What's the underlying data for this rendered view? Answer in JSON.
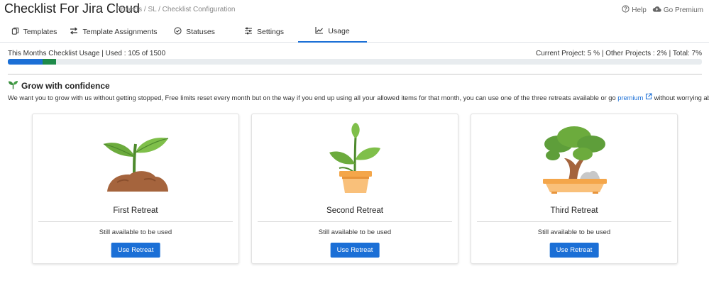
{
  "header": {
    "app_title": "Checklist For Jira Cloud",
    "breadcrumb": "Projects / SL / Checklist Configuration",
    "help_label": "Help",
    "premium_label": "Go Premium"
  },
  "tabs": [
    {
      "label": "Templates",
      "icon": "copy-icon"
    },
    {
      "label": "Template Assignments",
      "icon": "swap-arrows-icon"
    },
    {
      "label": "Statuses",
      "icon": "check-circle-icon"
    },
    {
      "label": "Settings",
      "icon": "sliders-icon"
    },
    {
      "label": "Usage",
      "icon": "chart-line-icon",
      "active": true
    }
  ],
  "usage": {
    "left_text": "This Months Checklist Usage | Used : 105 of 1500",
    "right_text": "Current Project: 5 % | Other Projects : 2% | Total: 7%",
    "current_project_percent": 5,
    "other_projects_percent": 2,
    "colors": {
      "current": "#1b6fd6",
      "other": "#1e8a4a"
    }
  },
  "section": {
    "title": "Grow with confidence",
    "desc_before": "We want you to grow with us without getting stopped, Free limits reset every month but on the way if you end up using all your allowed items for that month, you can use one of the three retreats available or go",
    "desc_link": "premium",
    "desc_after": "without worrying about limits."
  },
  "retreats": [
    {
      "title": "First Retreat",
      "status": "Still available to be used",
      "button_label": "Use Retreat",
      "illustration": "sprout-in-soil-icon"
    },
    {
      "title": "Second Retreat",
      "status": "Still available to be used",
      "button_label": "Use Retreat",
      "illustration": "plant-in-pot-icon"
    },
    {
      "title": "Third Retreat",
      "status": "Still available to be used",
      "button_label": "Use Retreat",
      "illustration": "bonsai-tree-icon"
    }
  ]
}
